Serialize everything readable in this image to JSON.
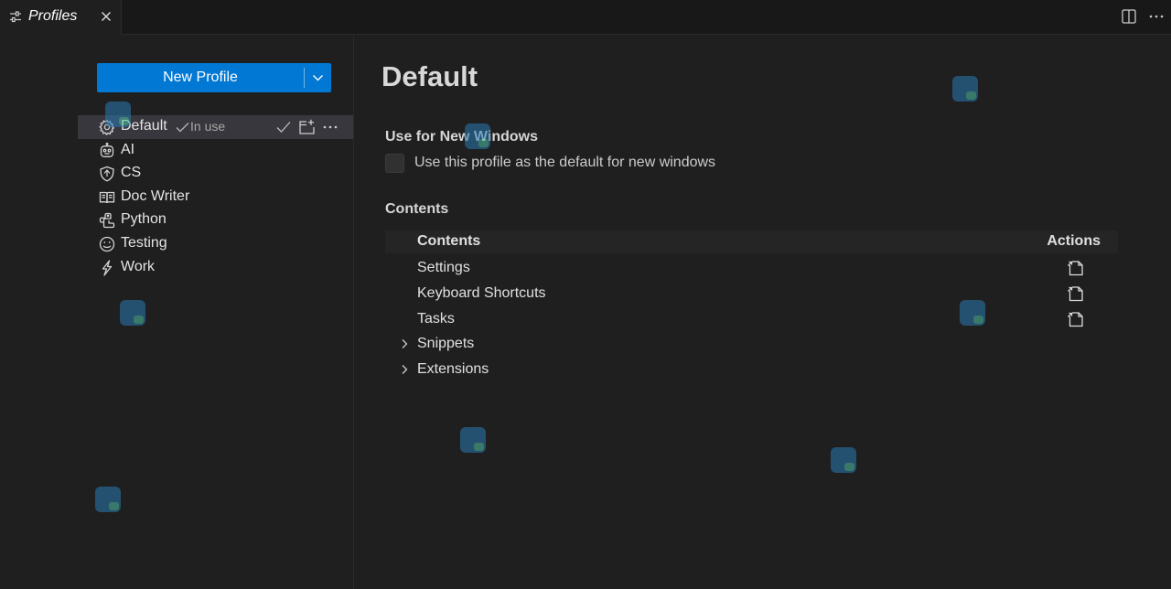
{
  "tab": {
    "title": "Profiles",
    "icon": "settings-sliders-icon",
    "close_icon": "close-icon"
  },
  "toolbar": {
    "split_icon": "split-editor-icon",
    "more_icon": "more-actions-icon"
  },
  "new_profile_button": {
    "label": "New Profile",
    "dropdown_icon": "chevron-down-icon",
    "color": "#0078d4"
  },
  "profiles": [
    {
      "name": "Default",
      "icon": "gear-icon",
      "selected": true,
      "in_use_label": "In use"
    },
    {
      "name": "AI",
      "icon": "robot-icon"
    },
    {
      "name": "CS",
      "icon": "shield-icon"
    },
    {
      "name": "Doc Writer",
      "icon": "book-icon"
    },
    {
      "name": "Python",
      "icon": "python-icon"
    },
    {
      "name": "Testing",
      "icon": "smiley-icon"
    },
    {
      "name": "Work",
      "icon": "lightning-icon"
    }
  ],
  "row_actions": [
    "check-icon",
    "new-window-icon",
    "more-actions-icon"
  ],
  "detail": {
    "title": "Default",
    "new_windows_section": "Use for New Windows",
    "new_windows_checkbox_label": "Use this profile as the default for new windows",
    "new_windows_checked": false,
    "contents_section": "Contents",
    "table": {
      "header_name": "Contents",
      "header_actions": "Actions",
      "rows": [
        {
          "name": "Settings",
          "expandable": false,
          "action_icon": "open-file-icon"
        },
        {
          "name": "Keyboard Shortcuts",
          "expandable": false,
          "action_icon": "open-file-icon"
        },
        {
          "name": "Tasks",
          "expandable": false,
          "action_icon": "open-file-icon"
        },
        {
          "name": "Snippets",
          "expandable": true
        },
        {
          "name": "Extensions",
          "expandable": true
        }
      ]
    }
  },
  "colors": {
    "background": "#1f1f1f",
    "tabbar": "#181818",
    "selected_row": "#37373d",
    "accent": "#0078d4"
  }
}
